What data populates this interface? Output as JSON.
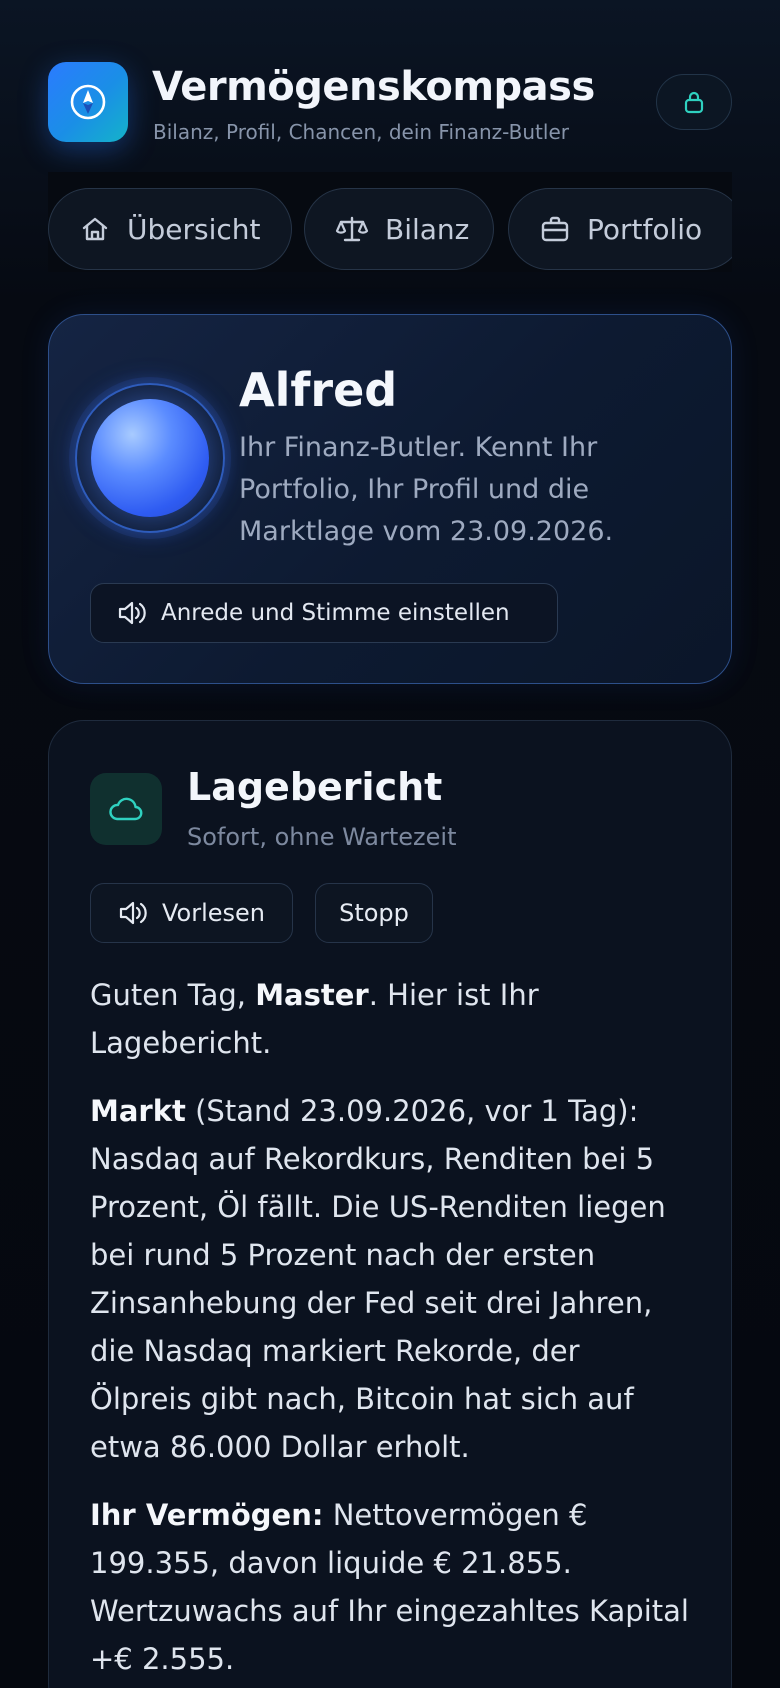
{
  "app": {
    "title": "Vermögenskompass",
    "subtitle": "Bilanz, Profil, Chancen, dein Finanz-Butler",
    "icon": "compass-icon",
    "lock_icon": "lock-icon"
  },
  "tabs": [
    {
      "label": "Übersicht",
      "icon": "home-icon"
    },
    {
      "label": "Bilanz",
      "icon": "scale-icon"
    },
    {
      "label": "Portfolio",
      "icon": "briefcase-icon"
    }
  ],
  "butler": {
    "name": "Alfred",
    "description": "Ihr Finanz-Butler. Kennt Ihr Portfolio, Ihr Profil und die Marktlage vom 23.09.2026.",
    "settings_button": "Anrede und Stimme einstellen",
    "settings_icon": "speaker-icon"
  },
  "report": {
    "title": "Lagebericht",
    "subtitle": "Sofort, ohne Wartezeit",
    "icon": "cloud-icon",
    "read_button": "Vorlesen",
    "stop_button": "Stopp",
    "greeting_pre": "Guten Tag, ",
    "greeting_name": "Master",
    "greeting_post": ". Hier ist Ihr Lagebericht.",
    "market_label": "Markt",
    "market_text": " (Stand 23.09.2026, vor 1 Tag): Nasdaq auf Rekordkurs, Renditen bei 5 Prozent, Öl fällt. Die US-Renditen liegen bei rund 5 Prozent nach der ersten Zinsanhebung der Fed seit drei Jahren, die Nasdaq markiert Rekorde, der Ölpreis gibt nach, Bitcoin hat sich auf etwa 86.000 Dollar erholt.",
    "wealth_label": "Ihr Vermögen:",
    "wealth_text": " Nettovermögen € 199.355, davon liquide € 21.855. Wertzuwachs auf Ihr eingezahltes Kapital +€ 2.555."
  },
  "colors": {
    "accent_blue": "#2b7bff",
    "accent_teal": "#2fd1c0",
    "background": "#05080f"
  }
}
